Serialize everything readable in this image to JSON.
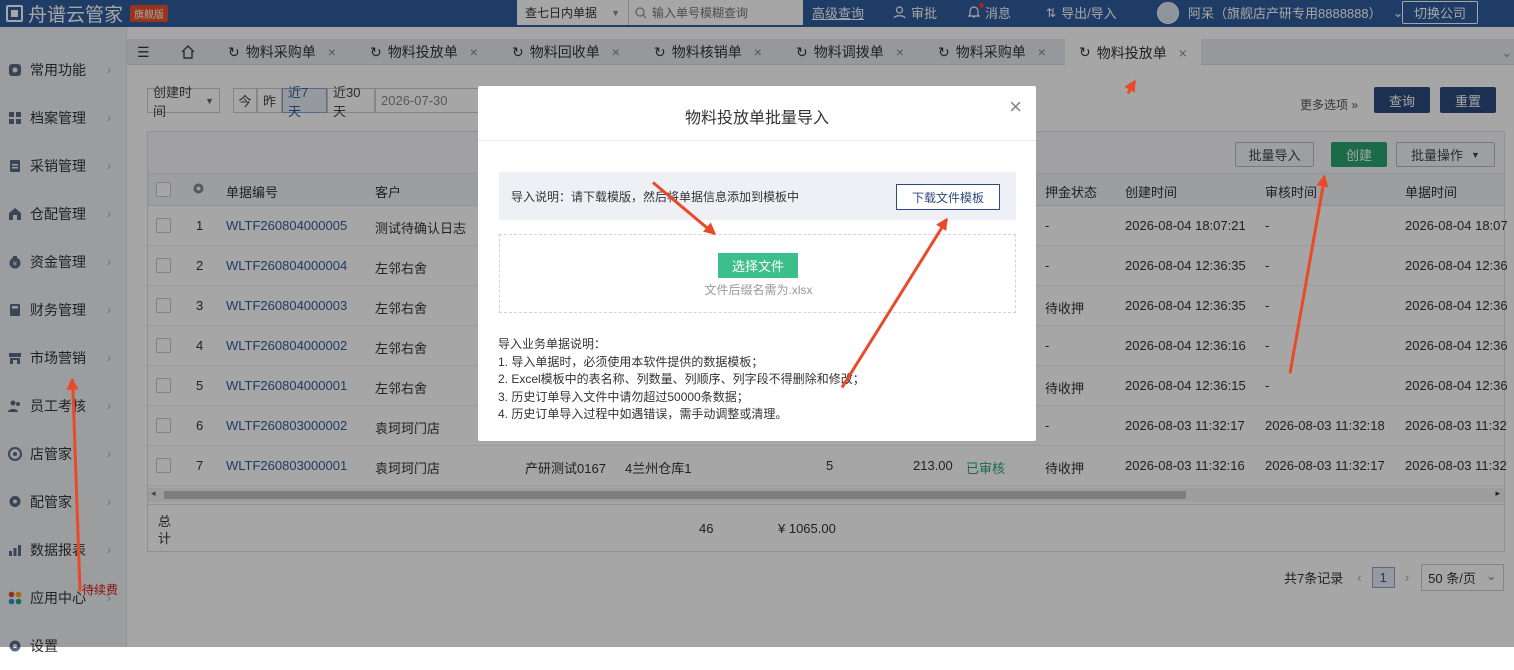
{
  "app": {
    "name": "舟谱云管家",
    "edition": "旗舰版"
  },
  "topbar": {
    "search_scope": "查七日内单据",
    "search_placeholder": "输入单号模糊查询",
    "advanced_search": "高级查询",
    "approve": "审批",
    "messages": "消息",
    "import_export": "导出/导入",
    "user": "阿呆（旗舰店产研专用8888888）",
    "switch_company": "切换公司"
  },
  "sidebar": {
    "items": [
      {
        "label": "常用功能",
        "icon": "star-icon"
      },
      {
        "label": "档案管理",
        "icon": "grid-icon"
      },
      {
        "label": "采销管理",
        "icon": "clipboard-icon"
      },
      {
        "label": "仓配管理",
        "icon": "warehouse-icon"
      },
      {
        "label": "资金管理",
        "icon": "money-bag-icon"
      },
      {
        "label": "财务管理",
        "icon": "calculator-icon"
      },
      {
        "label": "市场营销",
        "icon": "shop-icon"
      },
      {
        "label": "员工考核",
        "icon": "people-icon"
      },
      {
        "label": "店管家",
        "icon": "store-icon"
      },
      {
        "label": "配管家",
        "icon": "chat-icon"
      },
      {
        "label": "数据报表",
        "icon": "bar-chart-icon"
      },
      {
        "label": "应用中心",
        "icon": "apps-icon"
      },
      {
        "label": "设置",
        "icon": "gear-icon"
      }
    ],
    "annotation": "待续费"
  },
  "tabs": [
    "物料采购单",
    "物料投放单",
    "物料回收单",
    "物料核销单",
    "物料调拨单",
    "物料采购单",
    "物料投放单"
  ],
  "filters": {
    "date_type": "创建时间",
    "today": "今",
    "yesterday": "昨",
    "last7": "近7天",
    "last30": "近30天",
    "date_from": "2026-07-30",
    "more_options": "更多选项",
    "query": "查询",
    "reset": "重置"
  },
  "toolbar": {
    "batch_import": "批量导入",
    "create": "创建",
    "batch_ops": "批量操作"
  },
  "table": {
    "headers": {
      "no": "单据编号",
      "customer": "客户",
      "deposit": "押金状态",
      "created": "创建时间",
      "audited": "审核时间",
      "bill_time": "单据时间"
    },
    "rows": [
      {
        "idx": "1",
        "no": "WLTF260804000005",
        "customer": "测试待确认日志",
        "deposit": "-",
        "created": "2026-08-04 18:07:21",
        "audited": "-",
        "bill_time": "2026-08-04 18:07"
      },
      {
        "idx": "2",
        "no": "WLTF260804000004",
        "customer": "左邻右舍",
        "deposit": "-",
        "created": "2026-08-04 12:36:35",
        "audited": "-",
        "bill_time": "2026-08-04 12:36"
      },
      {
        "idx": "3",
        "no": "WLTF260804000003",
        "customer": "左邻右舍",
        "deposit": "待收押",
        "created": "2026-08-04 12:36:35",
        "audited": "-",
        "bill_time": "2026-08-04 12:36"
      },
      {
        "idx": "4",
        "no": "WLTF260804000002",
        "customer": "左邻右舍",
        "deposit": "-",
        "created": "2026-08-04 12:36:16",
        "audited": "-",
        "bill_time": "2026-08-04 12:36"
      },
      {
        "idx": "5",
        "no": "WLTF260804000001",
        "customer": "左邻右舍",
        "deposit": "待收押",
        "created": "2026-08-04 12:36:15",
        "audited": "-",
        "bill_time": "2026-08-04 12:36"
      },
      {
        "idx": "6",
        "no": "WLTF260803000002",
        "customer": "袁珂珂门店",
        "deposit": "-",
        "created": "2026-08-03 11:32:17",
        "audited": "2026-08-03 11:32:18",
        "bill_time": "2026-08-03 11:32"
      },
      {
        "idx": "7",
        "no": "WLTF260803000001",
        "customer": "袁珂珂门店",
        "salesman": "产研测试0167",
        "warehouse": "4兰州仓库1",
        "qty": "5",
        "amount": "213.00",
        "status": "已审核",
        "deposit": "待收押",
        "created": "2026-08-03 11:32:16",
        "audited": "2026-08-03 11:32:17",
        "bill_time": "2026-08-03 11:32"
      }
    ],
    "total_label": "总计",
    "total_qty": "46",
    "total_amount": "¥ 1065.00"
  },
  "pager": {
    "summary": "共7条记录",
    "page": "1",
    "page_size": "50 条/页"
  },
  "modal": {
    "title": "物料投放单批量导入",
    "notice": "导入说明：请下载模版，然后将单据信息添加到模板中",
    "download": "下载文件模板",
    "pick_file": "选择文件",
    "hint": "文件后缀名需为.xlsx",
    "notes_title": "导入业务单据说明：",
    "notes": [
      "1. 导入单据时，必须使用本软件提供的数据模板；",
      "2. Excel模板中的表名称、列数量、列顺序、列字段不得删除和修改；",
      "3. 历史订单导入文件中请勿超过50000条数据；",
      "4. 历史订单导入过程中如遇错误，需手动调整或清理。"
    ]
  },
  "colors": {
    "primary": "#2f5d9b",
    "green": "#2aa56f",
    "annotation": "#e84a2a"
  }
}
